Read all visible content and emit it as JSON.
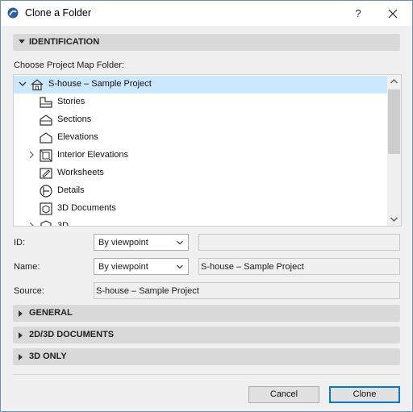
{
  "window": {
    "title": "Clone a Folder"
  },
  "sections": {
    "identification": "IDENTIFICATION",
    "general": "GENERAL",
    "documents": "2D/3D DOCUMENTS",
    "three_d_only": "3D ONLY"
  },
  "tree": {
    "label": "Choose Project Map Folder:",
    "items": [
      {
        "label": "S-house – Sample Project",
        "icon": "house-icon",
        "expander": "chevron-down",
        "selected": true
      },
      {
        "label": "Stories",
        "icon": "stories-icon",
        "expander": null,
        "selected": false
      },
      {
        "label": "Sections",
        "icon": "section-icon",
        "expander": null,
        "selected": false
      },
      {
        "label": "Elevations",
        "icon": "elevation-icon",
        "expander": null,
        "selected": false
      },
      {
        "label": "Interior Elevations",
        "icon": "interior-elevation-icon",
        "expander": "chevron-right",
        "selected": false
      },
      {
        "label": "Worksheets",
        "icon": "worksheet-icon",
        "expander": null,
        "selected": false
      },
      {
        "label": "Details",
        "icon": "detail-icon",
        "expander": null,
        "selected": false
      },
      {
        "label": "3D Documents",
        "icon": "3d-document-icon",
        "expander": null,
        "selected": false
      },
      {
        "label": "3D",
        "icon": "3d-icon",
        "expander": "chevron-right",
        "selected": false
      }
    ]
  },
  "fields": {
    "id": {
      "label": "ID:",
      "select": "By viewpoint",
      "value": ""
    },
    "name": {
      "label": "Name:",
      "select": "By viewpoint",
      "value": "S-house – Sample Project"
    },
    "source": {
      "label": "Source:",
      "value": "S-house – Sample Project"
    }
  },
  "buttons": {
    "cancel": "Cancel",
    "clone": "Clone"
  },
  "colors": {
    "selection": "#cce8ff",
    "primary_border": "#0078d7",
    "section_bar": "#d9d9d9"
  }
}
